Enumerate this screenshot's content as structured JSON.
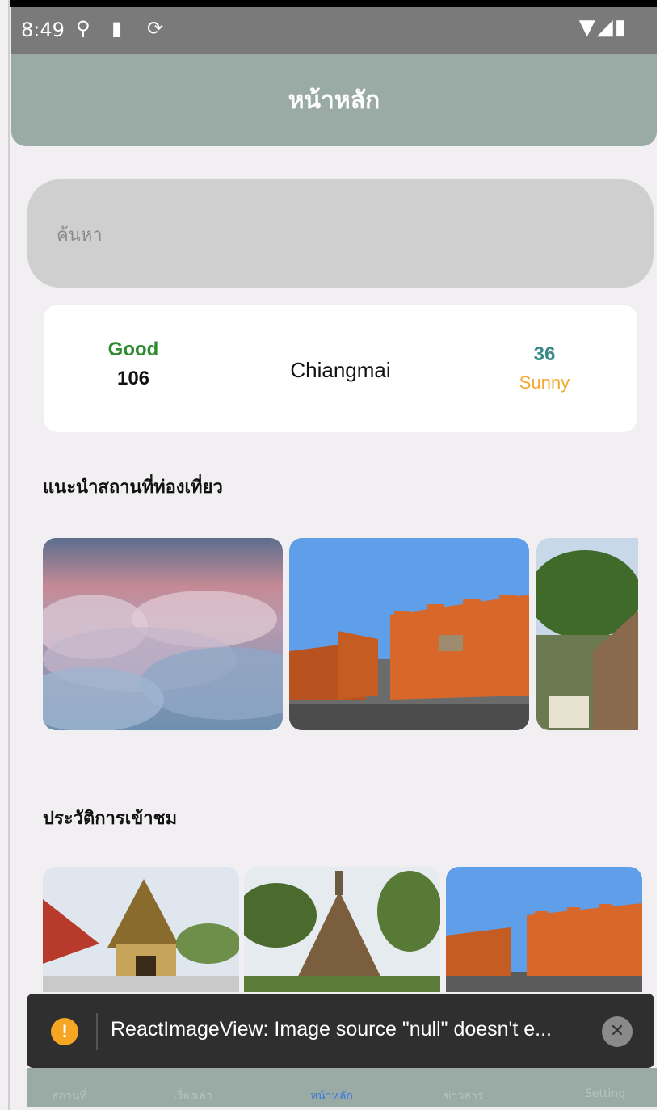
{
  "status_bar": {
    "time": "8:49",
    "icons": [
      "usb-icon",
      "sd-card-icon",
      "sync-icon"
    ],
    "right_icons": [
      "wifi-icon",
      "signal-icon",
      "battery-icon"
    ]
  },
  "header": {
    "title": "หน้าหลัก"
  },
  "search": {
    "placeholder": "ค้นหา"
  },
  "weather": {
    "air_quality_status": "Good",
    "air_quality_value": "106",
    "city": "Chiangmai",
    "temperature": "36",
    "condition": "Sunny"
  },
  "sections": {
    "recommended_title": "แนะนำสถานที่ท่องเที่ยว",
    "history_title": "ประวัติการเข้าชม"
  },
  "toast": {
    "message": "ReactImageView: Image source \"null\" doesn't e...",
    "icon": "warning-icon"
  },
  "tabs": [
    {
      "label": "สถานที่"
    },
    {
      "label": "เรื่องเล่า"
    },
    {
      "label": "หน้าหลัก"
    },
    {
      "label": "ข่าวสาร"
    },
    {
      "label": "Setting"
    }
  ],
  "colors": {
    "header": "#9aaba6",
    "good": "#2e8b2e",
    "temperature": "#3a8a86",
    "sunny": "#f3a92e",
    "active_tab": "#3c7ad6"
  }
}
